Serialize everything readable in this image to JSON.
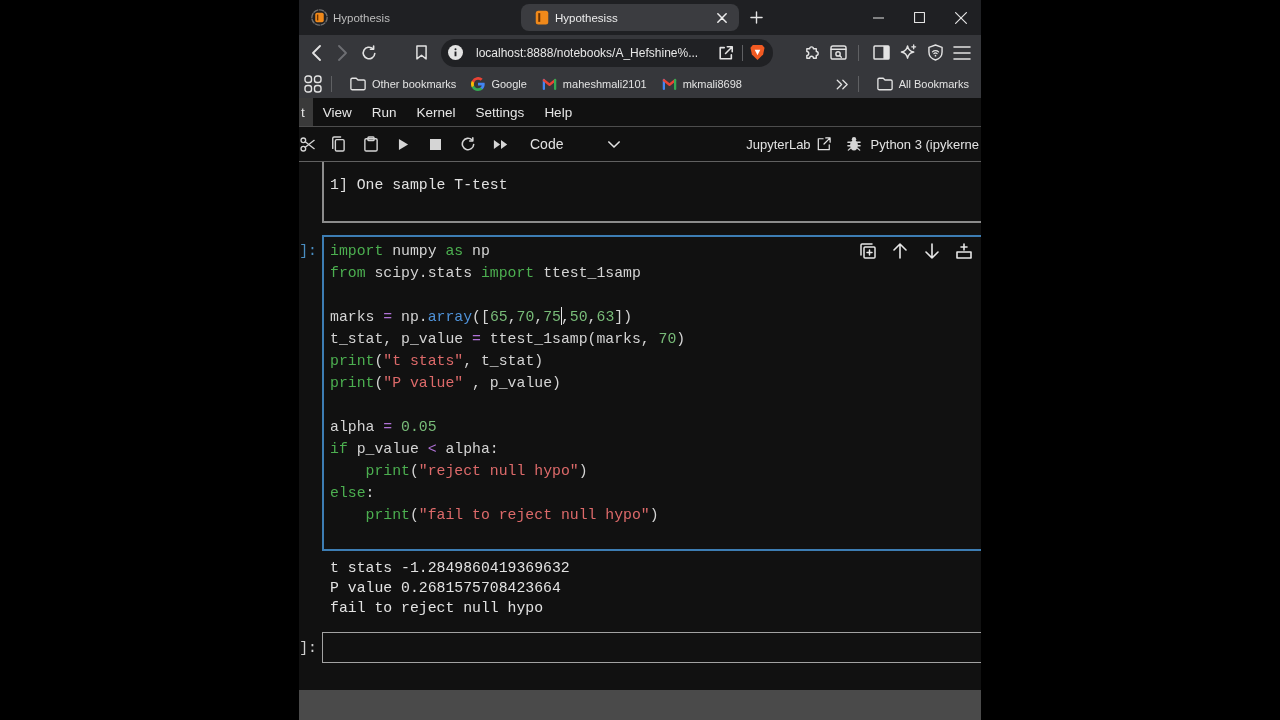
{
  "tabs": [
    {
      "title": "Hypothesis",
      "selected": false,
      "loading": true
    },
    {
      "title": "Hypothesiss",
      "selected": true,
      "loading": false
    }
  ],
  "browser_toolbar": {
    "back_button": {
      "disabled": false
    },
    "forward_button": {
      "disabled": true
    },
    "address": "localhost:8888/notebooks/A_Hefshine%..."
  },
  "bookmarks": [
    {
      "label": "Other bookmarks",
      "kind": "folder"
    },
    {
      "label": "Google",
      "kind": "search"
    },
    {
      "label": "maheshmali2101",
      "kind": "mail"
    },
    {
      "label": "mkmali8698",
      "kind": "mail"
    }
  ],
  "all_bookmarks": {
    "label": "All Bookmarks",
    "kind": "folder"
  },
  "menu": [
    {
      "label": "t",
      "selected": true
    },
    {
      "label": "View",
      "selected": false
    },
    {
      "label": "Run",
      "selected": false
    },
    {
      "label": "Kernel",
      "selected": false
    },
    {
      "label": "Settings",
      "selected": false
    },
    {
      "label": "Help",
      "selected": false
    }
  ],
  "notebook_toolbar": {
    "cell_type": "Code",
    "link": "JupyterLab",
    "kernel": "Python 3 (ipykerne"
  },
  "cells": [
    {
      "kind": "markdown",
      "selected": false,
      "text": "1] One sample T-test"
    },
    {
      "kind": "code",
      "selected": true,
      "prompt": "]:",
      "lines": [
        {
          "kind": "code",
          "tokens": [
            {
              "kind": "keyword",
              "text": "import"
            },
            {
              "kind": "name",
              "text": " numpy "
            },
            {
              "kind": "keyword",
              "text": "as"
            },
            {
              "kind": "name",
              "text": " np"
            }
          ]
        },
        {
          "kind": "code",
          "tokens": [
            {
              "kind": "keyword",
              "text": "from"
            },
            {
              "kind": "name",
              "text": " scipy.stats "
            },
            {
              "kind": "keyword",
              "text": "import"
            },
            {
              "kind": "name",
              "text": " ttest_1samp"
            }
          ]
        },
        {
          "kind": "blank"
        },
        {
          "kind": "code",
          "tokens": [
            {
              "kind": "name",
              "text": "marks "
            },
            {
              "kind": "operator",
              "text": "="
            },
            {
              "kind": "name",
              "text": " np."
            },
            {
              "kind": "attribute",
              "text": "array"
            },
            {
              "kind": "name",
              "text": "(["
            },
            {
              "kind": "number",
              "text": "65"
            },
            {
              "kind": "name",
              "text": ","
            },
            {
              "kind": "number",
              "text": "70"
            },
            {
              "kind": "name",
              "text": ","
            },
            {
              "kind": "number",
              "text": "75"
            },
            {
              "kind": "cursor"
            },
            {
              "kind": "name",
              "text": ","
            },
            {
              "kind": "number",
              "text": "50"
            },
            {
              "kind": "name",
              "text": ","
            },
            {
              "kind": "number",
              "text": "63"
            },
            {
              "kind": "name",
              "text": "])"
            }
          ]
        },
        {
          "kind": "code",
          "tokens": [
            {
              "kind": "name",
              "text": "t_stat, p_value "
            },
            {
              "kind": "operator",
              "text": "="
            },
            {
              "kind": "name",
              "text": " ttest_1samp(marks, "
            },
            {
              "kind": "number",
              "text": "70"
            },
            {
              "kind": "name",
              "text": ")"
            }
          ]
        },
        {
          "kind": "code",
          "tokens": [
            {
              "kind": "builtin",
              "text": "print"
            },
            {
              "kind": "name",
              "text": "("
            },
            {
              "kind": "string",
              "text": "\"t stats\""
            },
            {
              "kind": "name",
              "text": ", t_stat)"
            }
          ]
        },
        {
          "kind": "code",
          "tokens": [
            {
              "kind": "builtin",
              "text": "print"
            },
            {
              "kind": "name",
              "text": "("
            },
            {
              "kind": "string",
              "text": "\"P value\""
            },
            {
              "kind": "name",
              "text": " , p_value)"
            }
          ]
        },
        {
          "kind": "blank"
        },
        {
          "kind": "code",
          "tokens": [
            {
              "kind": "name",
              "text": "alpha"
            },
            {
              "kind": "operator",
              "text": " = "
            },
            {
              "kind": "number",
              "text": "0.05"
            }
          ]
        },
        {
          "kind": "code",
          "tokens": [
            {
              "kind": "keyword",
              "text": "if"
            },
            {
              "kind": "name",
              "text": " p_value "
            },
            {
              "kind": "operator",
              "text": "<"
            },
            {
              "kind": "name",
              "text": " alpha:"
            }
          ]
        },
        {
          "kind": "indented",
          "tokens": [
            {
              "kind": "builtin",
              "text": "print"
            },
            {
              "kind": "name",
              "text": "("
            },
            {
              "kind": "string",
              "text": "\"reject null hypo\""
            },
            {
              "kind": "name",
              "text": ")"
            }
          ]
        },
        {
          "kind": "code",
          "tokens": [
            {
              "kind": "keyword",
              "text": "else"
            },
            {
              "kind": "name",
              "text": ":"
            }
          ]
        },
        {
          "kind": "indented",
          "tokens": [
            {
              "kind": "builtin",
              "text": "print"
            },
            {
              "kind": "name",
              "text": "("
            },
            {
              "kind": "string",
              "text": "\"fail to reject null hypo\""
            },
            {
              "kind": "name",
              "text": ")"
            }
          ]
        }
      ],
      "outputs": [
        "t stats -1.2849860419369632",
        "P value 0.2681575708423664",
        "fail to reject null hypo"
      ]
    },
    {
      "kind": "code",
      "selected": false,
      "prompt": "]:"
    }
  ]
}
